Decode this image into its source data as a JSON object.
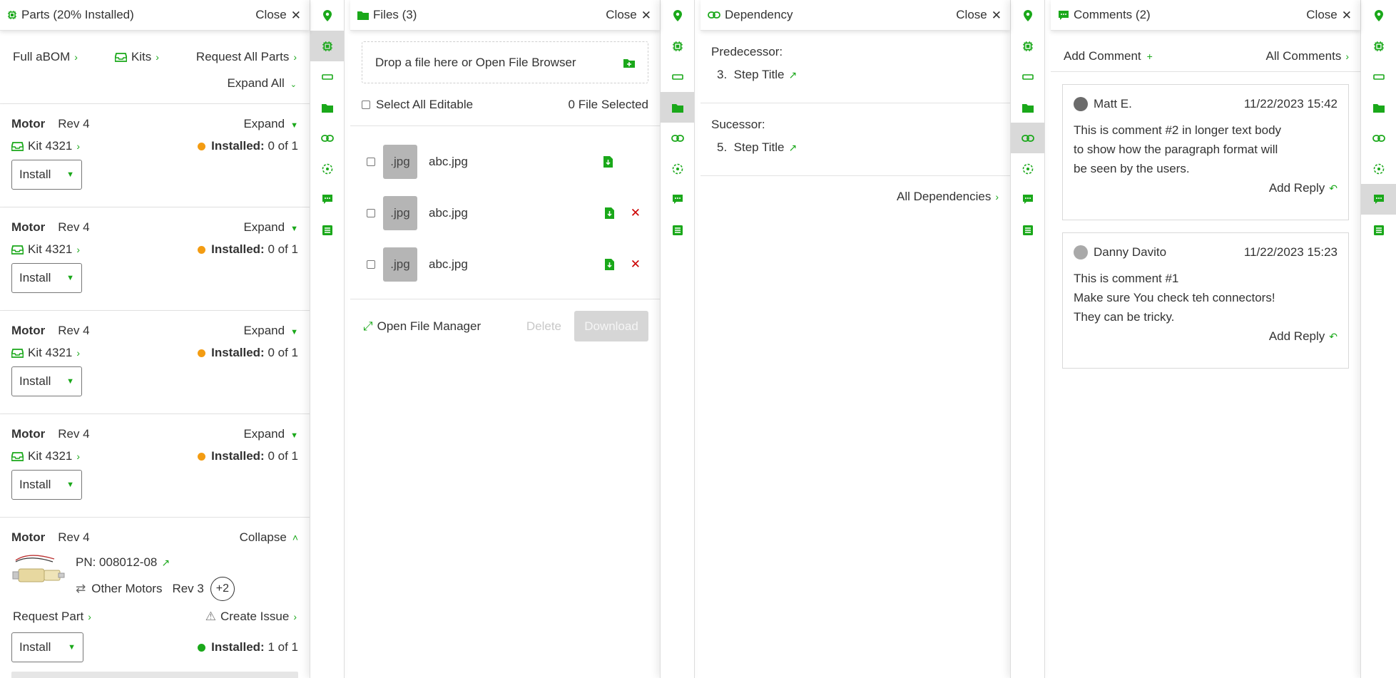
{
  "parts": {
    "title": "Parts (20% Installed)",
    "close_label": "Close",
    "full_abom": "Full aBOM",
    "kits": "Kits",
    "request_all": "Request All Parts",
    "expand_all": "Expand All",
    "motors": [
      {
        "name": "Motor",
        "rev": "Rev 4",
        "toggle": "Expand",
        "kit": "Kit 4321",
        "installed_label": "Installed:",
        "installed_value": "0 of 1",
        "status_color": "#f39c12",
        "action": "Install"
      },
      {
        "name": "Motor",
        "rev": "Rev 4",
        "toggle": "Expand",
        "kit": "Kit 4321",
        "installed_label": "Installed:",
        "installed_value": "0 of 1",
        "status_color": "#f39c12",
        "action": "Install"
      },
      {
        "name": "Motor",
        "rev": "Rev 4",
        "toggle": "Expand",
        "kit": "Kit 4321",
        "installed_label": "Installed:",
        "installed_value": "0 of 1",
        "status_color": "#f39c12",
        "action": "Install"
      },
      {
        "name": "Motor",
        "rev": "Rev 4",
        "toggle": "Expand",
        "kit": "Kit 4321",
        "installed_label": "Installed:",
        "installed_value": "0 of 1",
        "status_color": "#f39c12",
        "action": "Install"
      }
    ],
    "expanded": {
      "name": "Motor",
      "rev": "Rev 4",
      "toggle": "Collapse",
      "pn": "PN: 008012-08",
      "other": "Other Motors",
      "other_rev": "Rev 3",
      "more_count": "+2",
      "request_part": "Request Part",
      "create_issue": "Create Issue",
      "action": "Install",
      "installed_label": "Installed:",
      "installed_value": "1 of 1",
      "status_color": "#1aa81a"
    }
  },
  "files": {
    "title": "Files (3)",
    "close_label": "Close",
    "drop_text": "Drop a file here or Open File Browser",
    "select_all": "Select All Editable",
    "selected_count": "0 File Selected",
    "items": [
      {
        "ext": ".jpg",
        "name": "abc.jpg",
        "deletable": false
      },
      {
        "ext": ".jpg",
        "name": "abc.jpg",
        "deletable": true
      },
      {
        "ext": ".jpg",
        "name": "abc.jpg",
        "deletable": true
      }
    ],
    "open_manager": "Open File Manager",
    "delete_label": "Delete",
    "download_label": "Download"
  },
  "dependency": {
    "title": "Dependency",
    "close_label": "Close",
    "predecessor_label": "Predecessor:",
    "predecessor_num": "3.",
    "predecessor_title": "Step Title",
    "successor_label": "Sucessor:",
    "successor_num": "5.",
    "successor_title": "Step Title",
    "all_label": "All Dependencies"
  },
  "comments": {
    "title": "Comments (2)",
    "close_label": "Close",
    "add_label": "Add Comment",
    "all_label": "All Comments",
    "items": [
      {
        "author": "Matt E.",
        "date": "11/22/2023 15:42",
        "lines": [
          "This is comment #2 in longer text body",
          "to show how the paragraph format will",
          "be seen by the users."
        ],
        "reply": "Add Reply"
      },
      {
        "author": "Danny Davito",
        "date": "11/22/2023 15:23",
        "lines": [
          "This is comment #1",
          "Make sure You check teh connectors!",
          "They can be tricky."
        ],
        "reply": "Add Reply"
      }
    ]
  },
  "rail_icons": [
    "location-icon",
    "chip-icon",
    "bar-icon",
    "folder-icon",
    "link-icon",
    "cube-icon",
    "chat-icon",
    "list-icon"
  ],
  "colors": {
    "accent": "#1aa81a",
    "warning": "#f39c12",
    "danger": "#cc0000"
  }
}
